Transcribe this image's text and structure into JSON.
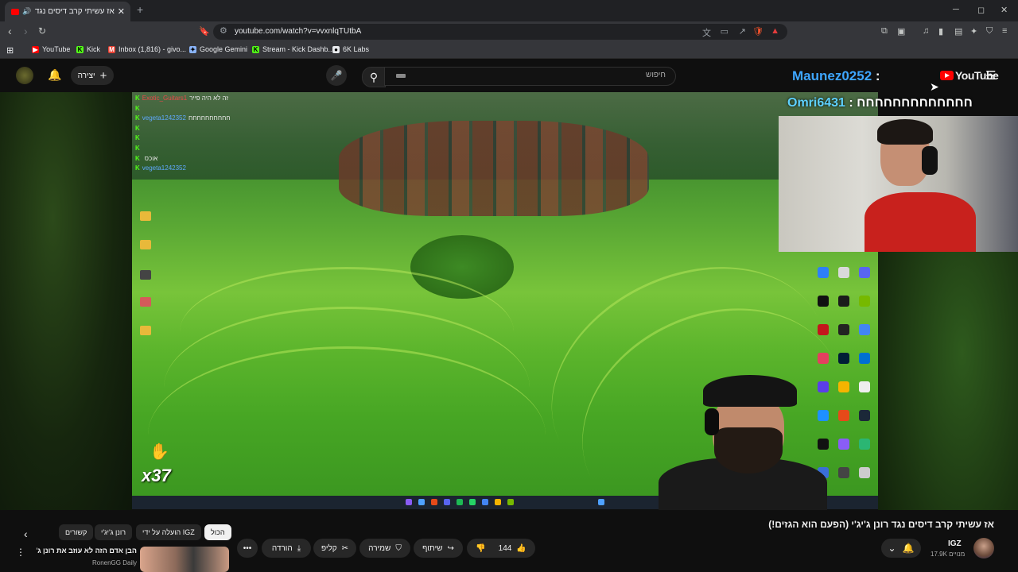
{
  "browser": {
    "tab_title": "אז עשיתי קרב דיסים נגד רונן ג",
    "new_tab": "+",
    "url": "youtube.com/watch?v=vvxnlqTUtbA",
    "window_controls": {
      "minimize": "─",
      "maximize": "◻",
      "close": "✕"
    },
    "bookmarks": [
      {
        "label": "YouTube",
        "color": "#ff0000"
      },
      {
        "label": "Kick",
        "color": "#53fc18"
      },
      {
        "label": "Inbox (1,816) - givo...",
        "color": "#ea4335"
      },
      {
        "label": "Google Gemini",
        "color": "#8ab4f8"
      },
      {
        "label": "Stream - Kick Dashb...",
        "color": "#53fc18"
      },
      {
        "label": "6K Labs",
        "color": "#e8eaed"
      }
    ]
  },
  "youtube": {
    "search_placeholder": "חיפוש",
    "create_label": "יצירה",
    "logo_text": "YouTube",
    "header_chat": {
      "user": "Maunez0252",
      "sep": " : "
    },
    "video_chat_top": {
      "user": "Omri6431",
      "sep": " : ",
      "message": "חחחחחחחחחחחחח"
    }
  },
  "stream_chat": [
    {
      "user": "Exotic_Guitars1",
      "message": "זה לא היה פייר",
      "cls": "u1"
    },
    {
      "user": "",
      "message": "",
      "cls": "u2"
    },
    {
      "user": "vegeta1242352",
      "message": "חחחחחחחחחח",
      "cls": "u2"
    },
    {
      "user": "",
      "message": "",
      "cls": "u2"
    },
    {
      "user": "",
      "message": "",
      "cls": "u2"
    },
    {
      "user": "",
      "message": "",
      "cls": "u3"
    },
    {
      "user": "",
      "message": "אוכס",
      "cls": "u3"
    },
    {
      "user": "vegeta1242352",
      "message": "",
      "cls": "u2"
    }
  ],
  "overlay": {
    "combo": "x37"
  },
  "video": {
    "title": "אז עשיתי קרב דיסים נגד רונן ג'יג'י (הפעם הוא הגזים!)",
    "channel": "IGZ",
    "subscribers": "17.9K מנויים",
    "likes": "144",
    "share": "שיתוף",
    "save": "שמירה",
    "clip": "קליפ",
    "download": "הורדה"
  },
  "chips": [
    {
      "label": "הכול",
      "active": true
    },
    {
      "label": "הועלה על ידי IGZ",
      "active": false
    },
    {
      "label": "רונן ג'יג'י",
      "active": false
    },
    {
      "label": "קשורים",
      "active": false
    }
  ],
  "recommended": {
    "title": "הבן אדם הזה לא עוזב את רונן ג'יג'י",
    "channel": "RonenGG Daily"
  }
}
